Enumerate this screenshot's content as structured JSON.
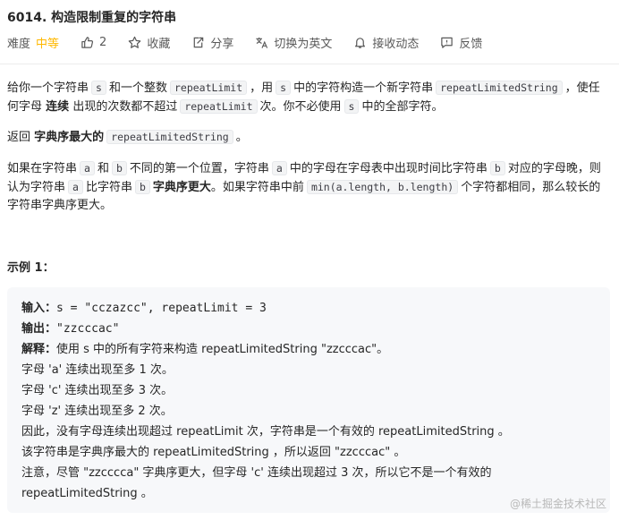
{
  "problem": {
    "title": "6014. 构造限制重复的字符串",
    "difficulty_label": "难度",
    "difficulty": "中等",
    "likes": "2",
    "favorite_label": "收藏",
    "share_label": "分享",
    "switch_lang_label": "切换为英文",
    "notify_label": "接收动态",
    "feedback_label": "反馈"
  },
  "description": {
    "p1": {
      "t1": "给你一个字符串",
      "c1": "s",
      "t2": "和一个整数",
      "c2": "repeatLimit",
      "t3": "，用",
      "c3": "s",
      "t4": "中的字符构造一个新字符串",
      "c4": "repeatLimitedString",
      "t5": "，使任何字母",
      "b1": "连续",
      "t6": "出现的次数都不超过",
      "c5": "repeatLimit",
      "t7": "次。你不必使用",
      "c6": "s",
      "t8": "中的全部字符。"
    },
    "p2": {
      "t1": "返回",
      "b1": "字典序最大的",
      "c1": "repeatLimitedString",
      "t2": "。"
    },
    "p3": {
      "t1": "如果在字符串",
      "c1": "a",
      "t2": "和",
      "c2": "b",
      "t3": "不同的第一个位置，字符串",
      "c3": "a",
      "t4": "中的字母在字母表中出现时间比字符串",
      "c4": "b",
      "t5": "对应的字母晚，则认为字符串",
      "c5": "a",
      "t6": "比字符串",
      "c6": "b",
      "b1": "字典序更大",
      "t7": "。如果字符串中前",
      "c7": "min(a.length, b.length)",
      "t8": "个字符都相同，那么较长的字符串字典序更大。"
    }
  },
  "example": {
    "title": "示例 1：",
    "input_label": "输入：",
    "input_value": "s = \"cczazcc\", repeatLimit = 3",
    "output_label": "输出：",
    "output_value": "\"zzcccac\"",
    "explain_label": "解释：",
    "explain_value": "使用 s 中的所有字符来构造 repeatLimitedString \"zzcccac\"。",
    "lines": [
      "字母 'a' 连续出现至多 1 次。",
      "字母 'c' 连续出现至多 3 次。",
      "字母 'z' 连续出现至多 2 次。",
      "因此，没有字母连续出现超过 repeatLimit 次，字符串是一个有效的 repeatLimitedString 。",
      "该字符串是字典序最大的 repeatLimitedString ，所以返回 \"zzcccac\" 。",
      "注意，尽管 \"zzcccca\" 字典序更大，但字母 'c' 连续出现超过 3 次，所以它不是一个有效的",
      "repeatLimitedString 。"
    ]
  },
  "watermark": "@稀土掘金技术社区"
}
